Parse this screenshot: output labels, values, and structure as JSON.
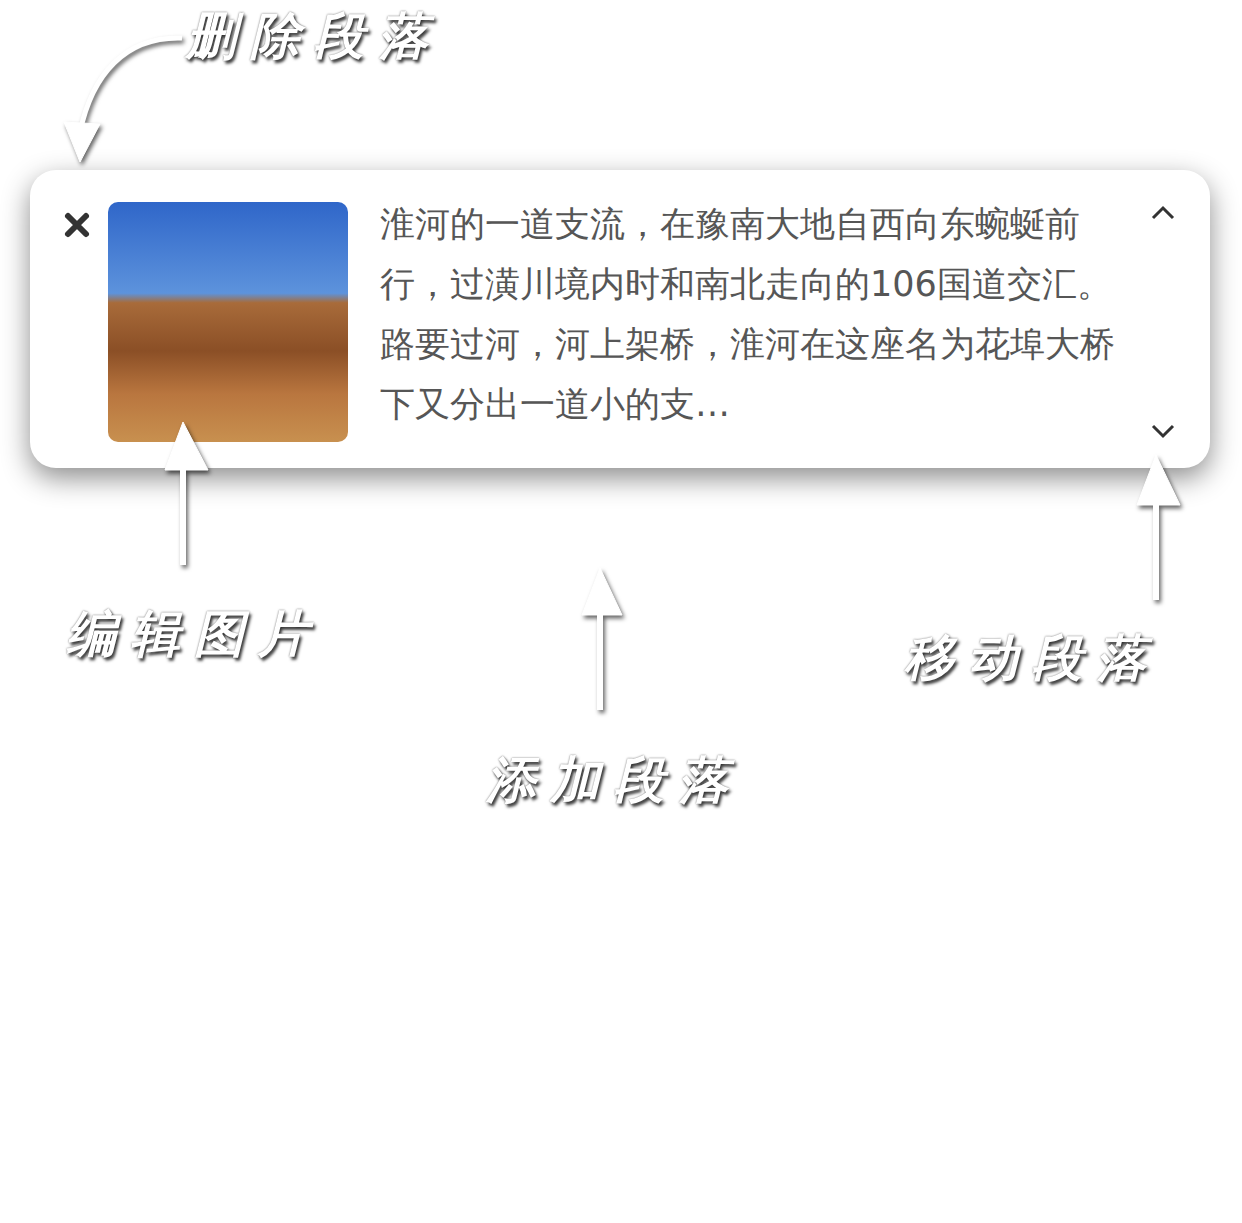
{
  "paragraph": {
    "text": "淮河的一道支流，在豫南大地自西向东蜿蜒前行，过潢川境内时和南北走向的106国道交汇。路要过河，河上架桥，淮河在这座名为花埠大桥下又分出一道小的支…"
  },
  "annotations": {
    "delete": "删除段落",
    "edit_image": "编辑图片",
    "add": "添加段落",
    "move": "移动段落"
  }
}
